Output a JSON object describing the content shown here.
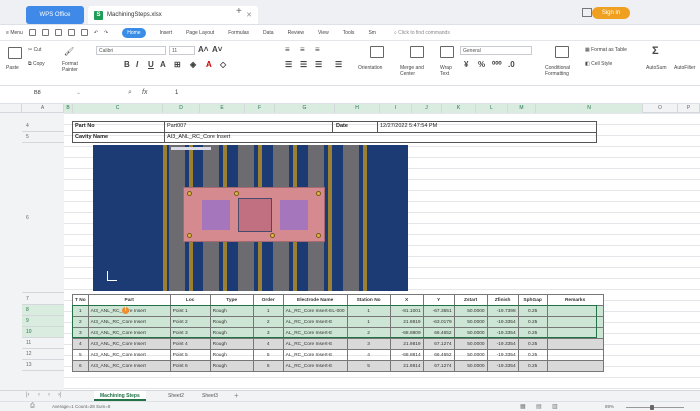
{
  "titlebar": {
    "app_tab": "WPS Office",
    "file_tab": "MachiningSteps.xlsx",
    "signin": "Sign in"
  },
  "menu": {
    "items": [
      "Menu",
      "Home",
      "Insert",
      "Page Layout",
      "Formulas",
      "Data",
      "Review",
      "View",
      "Tools"
    ],
    "more": "Sm",
    "search": "Click to find commands"
  },
  "ribbon": {
    "paste": "Paste",
    "cut": "Cut",
    "copy": "Copy",
    "format_painter": "Format Painter",
    "font_name": "Calibri",
    "font_size": "11",
    "orientation": "Orientation",
    "merge_center": "Merge and Center",
    "wrap_text": "Wrap Text",
    "number_format": "General",
    "conditional_formatting": "Conditional Formatting",
    "format_as_table": "Format as Table",
    "cell_style": "Cell Style",
    "autosum": "AutoSum",
    "autofilter": "AutoFilter"
  },
  "formula_bar": {
    "name_box": "B8",
    "fx": "fx",
    "value": "1"
  },
  "columns": [
    "A",
    "B",
    "C",
    "D",
    "E",
    "F",
    "G",
    "H",
    "I",
    "J",
    "K",
    "L",
    "M",
    "N",
    "O",
    "P"
  ],
  "rows": [
    "4",
    "5",
    "6",
    "7",
    "8",
    "9",
    "10",
    "11",
    "12",
    "13"
  ],
  "header_cells": {
    "part_no_label": "Part No",
    "part_no_value": "Part007",
    "date_label": "Date",
    "date_value": "12/27/2022 5:47:54 PM",
    "cavity_label": "Cavity Name",
    "cavity_value": "AI3_ANL_RC_Core Insert"
  },
  "table": {
    "columns": [
      "T No",
      "Part",
      "Loc",
      "Type",
      "Order",
      "Electrode Name",
      "Station No",
      "X",
      "Y",
      "Zstart",
      "Zfinish",
      "SphGap",
      "Remarks"
    ],
    "rows": [
      [
        "1",
        "AI3_ANL_RC_Core Insert",
        "Point 1",
        "Rough",
        "1",
        "AL_RC_Core Insert-EL-000",
        "1",
        "-81.1001",
        "-67.3651",
        "50.0000",
        "-19.7398",
        "0.25",
        ""
      ],
      [
        "2",
        "AI3_ANL_RC_Core Insert",
        "Point 2",
        "Rough",
        "2",
        "AL_RC_Core Insert-E",
        "1",
        "21.9819",
        "-63.0179",
        "50.0000",
        "-19.3354",
        "0.25",
        ""
      ],
      [
        "3",
        "AI3_ANL_RC_Core Insert",
        "Point 3",
        "Rough",
        "3",
        "AL_RC_Core Insert-E",
        "2",
        "-68.8809",
        "66.4652",
        "50.0000",
        "-19.3354",
        "0.25",
        ""
      ],
      [
        "4",
        "AI3_ANL_RC_Core Insert",
        "Point 4",
        "Rough",
        "4",
        "AL_RC_Core Insert-E",
        "3",
        "21.9819",
        "67.1274",
        "50.0000",
        "-19.3354",
        "0.25",
        ""
      ],
      [
        "5",
        "AI3_ANL_RC_Core Insert",
        "Point 5",
        "Rough",
        "5",
        "AL_RC_Core Insert-E",
        "4",
        "-68.8814",
        "66.4652",
        "50.0000",
        "-19.3354",
        "0.25",
        ""
      ],
      [
        "6",
        "AI3_ANL_RC_Core Insert",
        "Point 6",
        "Rough",
        "6",
        "AL_RC_Core Insert-E",
        "5",
        "21.9814",
        "67.1274",
        "50.0000",
        "-19.3354",
        "0.25",
        ""
      ]
    ]
  },
  "sheet_tabs": [
    "Machining Steps",
    "Sheet2",
    "Sheet3"
  ],
  "status": {
    "summary": "Average=1  Count=28  Sum=8",
    "zoom": "89%"
  }
}
